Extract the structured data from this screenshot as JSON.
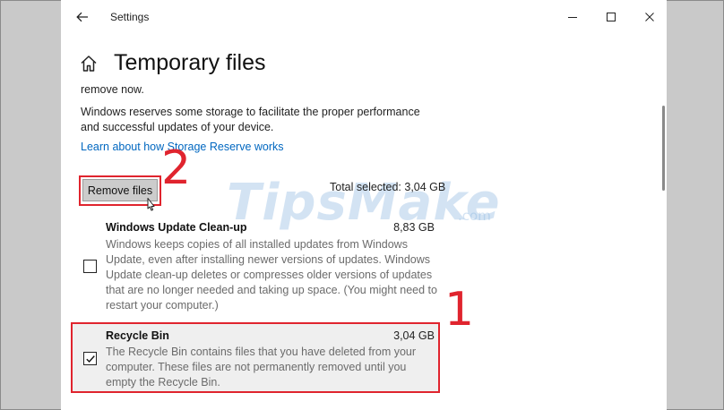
{
  "window": {
    "title": "Settings"
  },
  "page": {
    "title": "Temporary files",
    "cut_text": "remove now.",
    "reserve_text_line1": "Windows reserves some storage to facilitate the proper performance",
    "reserve_text_line2": "and successful updates of your device.",
    "reserve_link": "Learn about how Storage Reserve works"
  },
  "actions": {
    "remove_label": "Remove files",
    "total_selected": "Total selected: 3,04 GB"
  },
  "items": [
    {
      "title": "Windows Update Clean-up",
      "size": "8,83 GB",
      "checked": false,
      "desc": [
        "Windows keeps copies of all installed updates from Windows",
        "Update, even after installing newer versions of updates. Windows",
        "Update clean-up deletes or compresses older versions of updates",
        "that are no longer needed and taking up space. (You might need to",
        "restart your computer.)"
      ]
    },
    {
      "title": "Recycle Bin",
      "size": "3,04 GB",
      "checked": true,
      "desc": [
        "The Recycle Bin contains files that you have deleted from your",
        "computer. These files are not permanently removed until you",
        "empty the Recycle Bin."
      ]
    }
  ],
  "annotations": {
    "step1": "1",
    "step2": "2"
  },
  "watermark": {
    "text": "TipsMake",
    "domain": ".com"
  },
  "colors": {
    "link": "#0067c0",
    "highlight_red": "#e0242e",
    "button_bg": "#cccccc"
  },
  "icons": {
    "back": "back-arrow-icon",
    "home": "home-icon",
    "minimize": "minimize-icon",
    "maximize": "maximize-icon",
    "close": "close-icon",
    "cursor": "mouse-cursor-icon",
    "check": "checkmark-icon"
  }
}
